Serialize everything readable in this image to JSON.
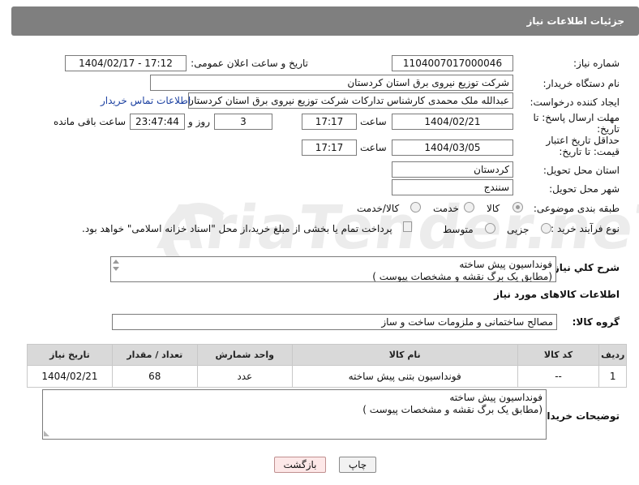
{
  "header": {
    "title": "جزئیات اطلاعات نیاز"
  },
  "labels": {
    "need_number": "شماره نیاز:",
    "announce_datetime": "تاریخ و ساعت اعلان عمومی:",
    "buyer_org": "نام دستگاه خریدار:",
    "requester": "ایجاد کننده درخواست:",
    "reply_deadline": "مهلت ارسال پاسخ: تا تاریخ:",
    "price_validity": "حداقل تاریخ اعتبار قیمت: تا تاریخ:",
    "hour": "ساعت",
    "days_and": "روز و",
    "remaining": "ساعت باقی مانده",
    "delivery_province": "استان محل تحویل:",
    "delivery_city": "شهر محل تحویل:",
    "category": "طبقه بندی موضوعی:",
    "purchase_type": "نوع فرآیند خرید :",
    "summary": "شرح کلي نياز:",
    "goods_info": "اطلاعات کالاهای مورد نیاز",
    "goods_group": "گروه کالا:",
    "buyer_notes": "توضیحات خریدار:"
  },
  "fields": {
    "need_number": "1104007017000046",
    "announce_datetime": "1404/02/17 - 17:12",
    "buyer_org": "شرکت توزیع نیروی برق استان کردستان",
    "requester": "عبدالله ملک محمدی کارشناس تدارکات شرکت توزیع نیروی برق استان کردستان",
    "contact_link": "اطلاعات تماس خریدار",
    "reply_date": "1404/02/21",
    "reply_time": "17:17",
    "reply_days": "3",
    "reply_remaining": "23:47:44",
    "validity_date": "1404/03/05",
    "validity_time": "17:17",
    "province": "کردستان",
    "city": "سنندج",
    "goods_group": "مصالح ساختمانی و ملزومات ساخت و ساز"
  },
  "category_options": [
    {
      "label": "کالا",
      "selected": true
    },
    {
      "label": "خدمت",
      "selected": false
    },
    {
      "label": "کالا/خدمت",
      "selected": false
    }
  ],
  "purchase_options": [
    {
      "label": "جزیی",
      "selected": false
    },
    {
      "label": "متوسط",
      "selected": false
    }
  ],
  "payment_note": "پرداخت تمام یا بخشی از مبلغ خرید،از محل \"اسناد خزانه اسلامی\" خواهد بود.",
  "summary_text": "فونداسیون پیش ساخته\n(مطابق یک برگ نقشه و مشخصات پیوست )",
  "buyer_notes_text": "فونداسیون پیش ساخته\n(مطابق یک برگ نقشه و مشخصات پیوست )",
  "table": {
    "headers": [
      "ردیف",
      "کد کالا",
      "نام کالا",
      "واحد شمارش",
      "تعداد / مقدار",
      "تاریخ نیاز"
    ],
    "rows": [
      [
        "1",
        "--",
        "فونداسیون بتنی پیش ساخته",
        "عدد",
        "68",
        "1404/02/21"
      ]
    ]
  },
  "buttons": {
    "print": "چاپ",
    "back": "بازگشت"
  },
  "watermark": "AriaTender.neT"
}
